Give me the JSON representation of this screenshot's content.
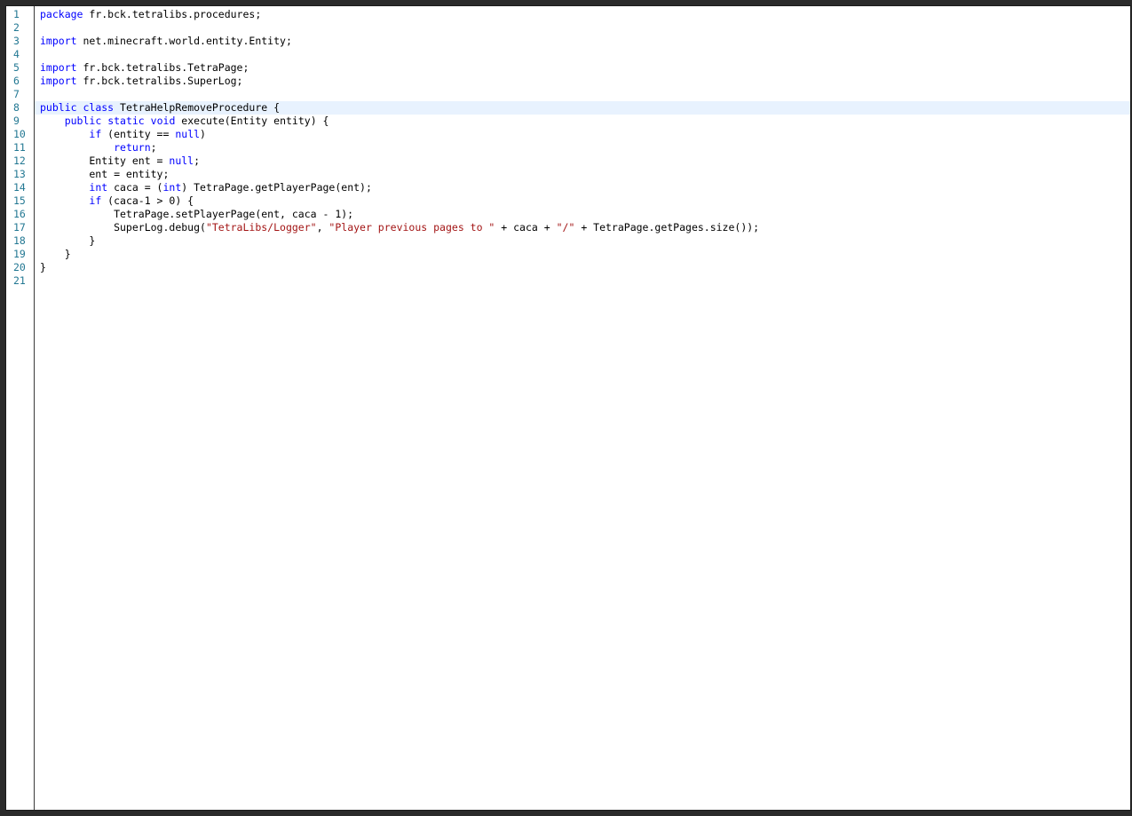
{
  "editor": {
    "language": "java",
    "highlighted_line": 8,
    "colors": {
      "keyword": "#0000ff",
      "string": "#a31515",
      "line_number": "#237893",
      "highlight": "#e8f2fe",
      "text": "#000000"
    },
    "lines": [
      {
        "n": "1",
        "tokens": [
          {
            "t": "kw",
            "v": "package"
          },
          {
            "t": "p",
            "v": " fr.bck.tetralibs.procedures;"
          }
        ]
      },
      {
        "n": "2",
        "tokens": []
      },
      {
        "n": "3",
        "tokens": [
          {
            "t": "kw",
            "v": "import"
          },
          {
            "t": "p",
            "v": " net.minecraft.world.entity.Entity;"
          }
        ]
      },
      {
        "n": "4",
        "tokens": []
      },
      {
        "n": "5",
        "tokens": [
          {
            "t": "kw",
            "v": "import"
          },
          {
            "t": "p",
            "v": " fr.bck.tetralibs.TetraPage;"
          }
        ]
      },
      {
        "n": "6",
        "tokens": [
          {
            "t": "kw",
            "v": "import"
          },
          {
            "t": "p",
            "v": " fr.bck.tetralibs.SuperLog;"
          }
        ]
      },
      {
        "n": "7",
        "tokens": []
      },
      {
        "n": "8",
        "tokens": [
          {
            "t": "kw",
            "v": "public"
          },
          {
            "t": "p",
            "v": " "
          },
          {
            "t": "kw",
            "v": "class"
          },
          {
            "t": "p",
            "v": " TetraHelpRemoveProcedure {"
          }
        ]
      },
      {
        "n": "9",
        "tokens": [
          {
            "t": "p",
            "v": "    "
          },
          {
            "t": "kw",
            "v": "public"
          },
          {
            "t": "p",
            "v": " "
          },
          {
            "t": "kw",
            "v": "static"
          },
          {
            "t": "p",
            "v": " "
          },
          {
            "t": "kw",
            "v": "void"
          },
          {
            "t": "p",
            "v": " execute(Entity entity) {"
          }
        ]
      },
      {
        "n": "10",
        "tokens": [
          {
            "t": "p",
            "v": "        "
          },
          {
            "t": "kw",
            "v": "if"
          },
          {
            "t": "p",
            "v": " (entity == "
          },
          {
            "t": "kw",
            "v": "null"
          },
          {
            "t": "p",
            "v": ")"
          }
        ]
      },
      {
        "n": "11",
        "tokens": [
          {
            "t": "p",
            "v": "            "
          },
          {
            "t": "kw",
            "v": "return"
          },
          {
            "t": "p",
            "v": ";"
          }
        ]
      },
      {
        "n": "12",
        "tokens": [
          {
            "t": "p",
            "v": "        Entity ent = "
          },
          {
            "t": "kw",
            "v": "null"
          },
          {
            "t": "p",
            "v": ";"
          }
        ]
      },
      {
        "n": "13",
        "tokens": [
          {
            "t": "p",
            "v": "        ent = entity;"
          }
        ]
      },
      {
        "n": "14",
        "tokens": [
          {
            "t": "p",
            "v": "        "
          },
          {
            "t": "kw",
            "v": "int"
          },
          {
            "t": "p",
            "v": " caca = ("
          },
          {
            "t": "kw",
            "v": "int"
          },
          {
            "t": "p",
            "v": ") TetraPage.getPlayerPage(ent);"
          }
        ]
      },
      {
        "n": "15",
        "tokens": [
          {
            "t": "p",
            "v": "        "
          },
          {
            "t": "kw",
            "v": "if"
          },
          {
            "t": "p",
            "v": " (caca-1 > 0) {"
          }
        ]
      },
      {
        "n": "16",
        "tokens": [
          {
            "t": "p",
            "v": "            TetraPage.setPlayerPage(ent, caca - 1);"
          }
        ]
      },
      {
        "n": "17",
        "tokens": [
          {
            "t": "p",
            "v": "            SuperLog.debug("
          },
          {
            "t": "str",
            "v": "\"TetraLibs/Logger\""
          },
          {
            "t": "p",
            "v": ", "
          },
          {
            "t": "str",
            "v": "\"Player previous pages to \""
          },
          {
            "t": "p",
            "v": " + caca + "
          },
          {
            "t": "str",
            "v": "\"/\""
          },
          {
            "t": "p",
            "v": " + TetraPage.getPages.size());"
          }
        ]
      },
      {
        "n": "18",
        "tokens": [
          {
            "t": "p",
            "v": "        }"
          }
        ]
      },
      {
        "n": "19",
        "tokens": [
          {
            "t": "p",
            "v": "    }"
          }
        ]
      },
      {
        "n": "20",
        "tokens": [
          {
            "t": "p",
            "v": "}"
          }
        ]
      },
      {
        "n": "21",
        "tokens": []
      }
    ]
  }
}
